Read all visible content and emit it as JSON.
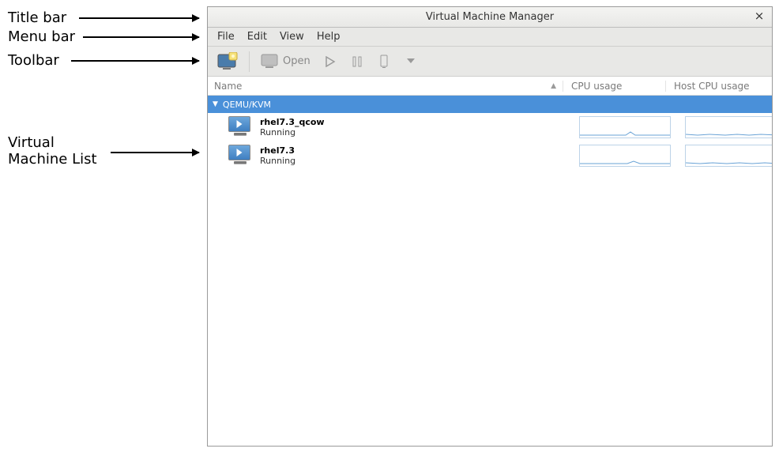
{
  "annotations": {
    "title_bar": "Title bar",
    "menu_bar": "Menu bar",
    "toolbar": "Toolbar",
    "vm_list_l1": "Virtual",
    "vm_list_l2": "Machine List"
  },
  "window": {
    "title": "Virtual Machine Manager"
  },
  "menubar": {
    "items": [
      "File",
      "Edit",
      "View",
      "Help"
    ]
  },
  "toolbar": {
    "open_label": "Open"
  },
  "columns": {
    "name": "Name",
    "cpu": "CPU usage",
    "host_cpu": "Host CPU usage"
  },
  "group": {
    "label": "QEMU/KVM"
  },
  "vms": [
    {
      "name": "rhel7.3_qcow",
      "status": "Running"
    },
    {
      "name": "rhel7.3",
      "status": "Running"
    }
  ]
}
